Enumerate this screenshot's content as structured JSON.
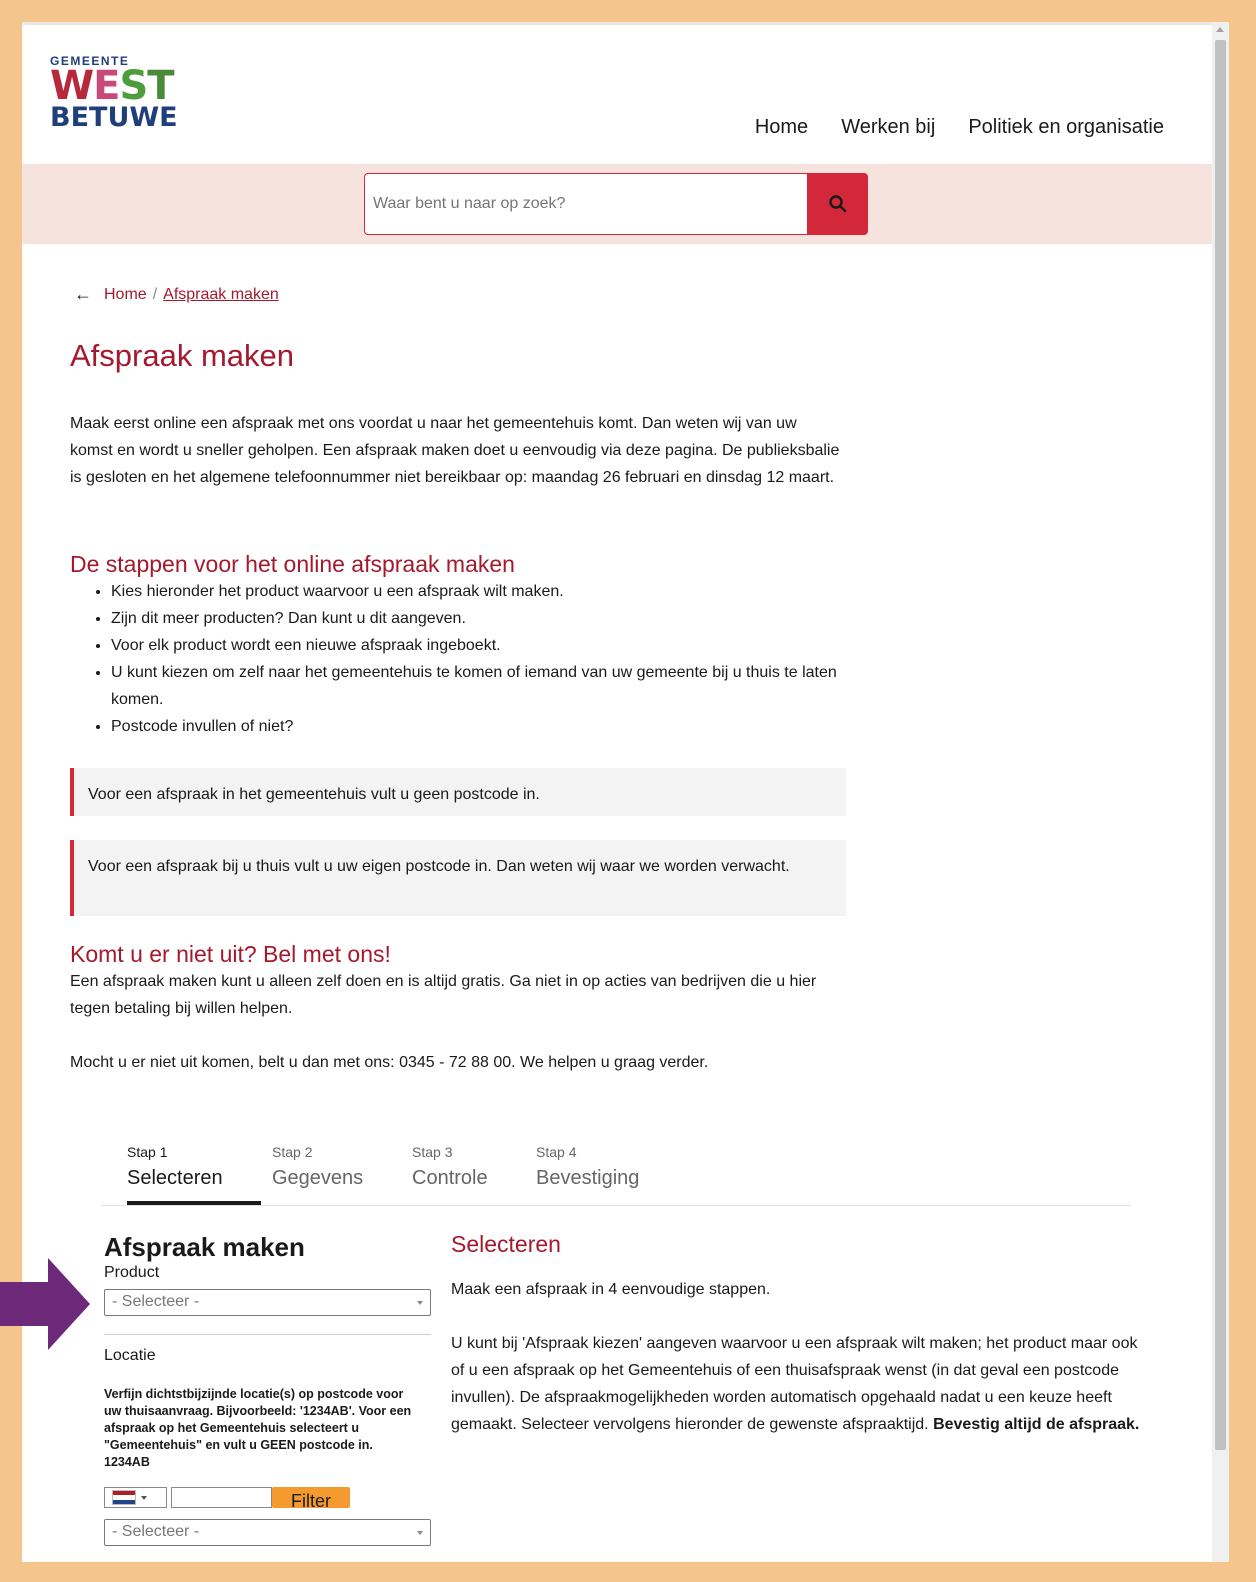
{
  "logo": {
    "small": "GEMEENTE",
    "line1": [
      "W",
      "E",
      "S",
      "T"
    ],
    "line2": "BETUWE"
  },
  "nav": [
    "Home",
    "Werken bij",
    "Politiek en organisatie"
  ],
  "search": {
    "placeholder": "Waar bent u naar op zoek?",
    "icon": "search-icon",
    "accent": "#d3273a"
  },
  "breadcrumb": {
    "arrow": "←",
    "home": "Home",
    "sep": "/",
    "current": "Afspraak maken"
  },
  "page": {
    "title": "Afspraak maken",
    "intro": "Maak eerst online een afspraak met ons voordat u naar het gemeentehuis komt. Dan weten wij van uw komst en wordt u sneller geholpen. Een afspraak maken doet u eenvoudig via deze pagina. De publieksbalie is gesloten en het algemene telefoonnummer niet bereikbaar op: maandag 26 februari en dinsdag 12 maart.",
    "steps_heading": "De stappen voor het online afspraak maken",
    "steps": [
      "Kies hieronder het product waarvoor u een afspraak wilt maken.",
      "Zijn dit meer producten? Dan kunt u dit aangeven.",
      "Voor elk product wordt een nieuwe afspraak ingeboekt.",
      "U kunt kiezen om zelf naar het gemeentehuis te komen of iemand van uw gemeente bij u thuis te laten komen.",
      "Postcode invullen of niet?"
    ],
    "note1": "Voor een afspraak in het gemeentehuis vult u geen postcode in.",
    "note2": "Voor een afspraak bij u thuis vult u uw eigen postcode in. Dan weten wij waar we worden verwacht.",
    "call_heading": "Komt u er niet uit? Bel met ons!",
    "call_text1": "Een afspraak maken kunt u alleen zelf doen en is altijd gratis. Ga niet in op acties van bedrijven die u hier tegen betaling bij willen helpen.",
    "call_text2": "Mocht u er niet uit komen, belt u dan met ons: 0345 - 72 88 00. We helpen u graag verder."
  },
  "wizard": {
    "tabs": [
      {
        "step": "Stap 1",
        "name": "Selecteren"
      },
      {
        "step": "Stap 2",
        "name": "Gegevens"
      },
      {
        "step": "Stap 3",
        "name": "Controle"
      },
      {
        "step": "Stap 4",
        "name": "Bevestiging"
      }
    ],
    "form_title": "Afspraak maken",
    "product_label": "Product",
    "product_select": "- Selecteer -",
    "location_label": "Locatie",
    "location_help": "Verfijn dichtstbijzijnde locatie(s) op postcode voor uw thuisaanvraag. Bijvoorbeeld: '1234AB'. Voor een afspraak op het Gemeentehuis selecteert u \"Gemeentehuis\" en vult u GEEN postcode in. 1234AB",
    "filter_button": "Filter",
    "location_select": "- Selecteer -",
    "side_heading": "Selecteren",
    "side_p1": "Maak een afspraak in 4 eenvoudige stappen.",
    "side_p2": "U kunt bij 'Afspraak kiezen' aangeven waarvoor u een afspraak wilt maken; het product maar ook of u een afspraak op het Gemeentehuis of een thuisafspraak wenst (in dat geval een postcode invullen). De afspraakmogelijkheden worden automatisch opgehaald nadat u een keuze heeft gemaakt. Selecteer vervolgens hieronder de gewenste afspraaktijd.",
    "side_p2_bold": "Bevestig altijd de afspraak."
  },
  "colors": {
    "accent": "#a5192e",
    "frame": "#f5c58e",
    "arrow": "#6d2a7a",
    "filter": "#f59a2e"
  }
}
